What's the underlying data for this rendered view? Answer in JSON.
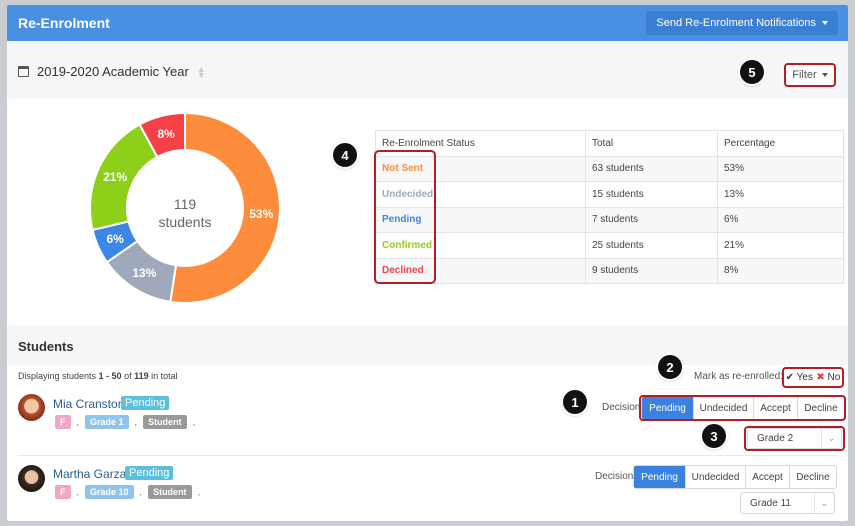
{
  "header": {
    "title": "Re-Enrolment",
    "notify_label": "Send Re-Enrolment Notifications"
  },
  "year": {
    "label": "2019-2020 Academic Year"
  },
  "filter": {
    "label": "Filter"
  },
  "markers": [
    "1",
    "2",
    "3",
    "4",
    "5"
  ],
  "chart_data": {
    "type": "pie",
    "center_value": "119",
    "center_unit": "students",
    "slices": [
      {
        "label": "Not Sent",
        "value": 53,
        "text": "53%",
        "color": "#fd8c3c"
      },
      {
        "label": "Undecided",
        "value": 13,
        "text": "13%",
        "color": "#a0a9bb"
      },
      {
        "label": "Pending",
        "value": 6,
        "text": "6%",
        "color": "#3c86e6"
      },
      {
        "label": "Confirmed",
        "value": 21,
        "text": "21%",
        "color": "#8ecf1a"
      },
      {
        "label": "Declined",
        "value": 8,
        "text": "8%",
        "color": "#f44046"
      }
    ]
  },
  "status_table": {
    "headers": [
      "Re-Enrolment Status",
      "Total",
      "Percentage"
    ],
    "rows": [
      {
        "status": "Not Sent",
        "color": "#fd8c3c",
        "total": "63 students",
        "pct": "53%"
      },
      {
        "status": "Undecided",
        "color": "#a0a9bb",
        "total": "15 students",
        "pct": "13%"
      },
      {
        "status": "Pending",
        "color": "#3c86e6",
        "total": "7 students",
        "pct": "6%"
      },
      {
        "status": "Confirmed",
        "color": "#8ecf1a",
        "total": "25 students",
        "pct": "21%"
      },
      {
        "status": "Declined",
        "color": "#f44046",
        "total": "9 students",
        "pct": "8%"
      }
    ]
  },
  "students_section": {
    "title": "Students",
    "displaying_prefix": "Displaying students ",
    "displaying_range": "1 - 50",
    "displaying_of": " of ",
    "displaying_total": "119",
    "displaying_suffix": " in total",
    "mark_label": "Mark as re-enrolled:",
    "mark_yes": "Yes",
    "mark_no": "No",
    "decision_label": "Decision:",
    "decision_options": [
      "Pending",
      "Undecided",
      "Accept",
      "Decline"
    ]
  },
  "students": [
    {
      "name": "Mia Cranston",
      "status": "Pending",
      "tags": [
        "F",
        "Grade 1",
        "Student"
      ],
      "grade": "Grade 2",
      "decision": "Pending"
    },
    {
      "name": "Martha Garza",
      "status": "Pending",
      "tags": [
        "F",
        "Grade 10",
        "Student"
      ],
      "grade": "Grade 11",
      "decision": "Pending"
    }
  ]
}
